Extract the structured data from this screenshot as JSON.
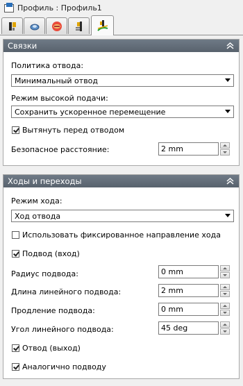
{
  "window": {
    "title": "Профиль : Профиль1"
  },
  "tabs": [
    {
      "icon": "tool-icon"
    },
    {
      "icon": "geometry-icon"
    },
    {
      "icon": "heights-icon"
    },
    {
      "icon": "passes-icon"
    },
    {
      "icon": "linking-icon",
      "active": true
    }
  ],
  "links": {
    "header": "Связки",
    "retract_policy_label": "Политика отвода:",
    "retract_policy_value": "Минимальный отвод",
    "high_feed_label": "Режим высокой подачи:",
    "high_feed_value": "Сохранить ускоренное перемещение",
    "extend_before_retract_label": "Вытянуть перед отводом",
    "extend_before_retract_checked": true,
    "safe_distance_label": "Безопасное расстояние:",
    "safe_distance_value": "2 mm"
  },
  "leads": {
    "header": "Ходы и переходы",
    "lead_mode_label": "Режим хода:",
    "lead_mode_value": "Ход отвода",
    "fixed_direction_label": "Использовать фиксированное направление хода",
    "fixed_direction_checked": false,
    "lead_in_label": "Подвод (вход)",
    "lead_in_checked": true,
    "lead_radius_label": "Радиус подвода:",
    "lead_radius_value": "0 mm",
    "linear_lead_length_label": "Длина линейного подвода:",
    "linear_lead_length_value": "2 mm",
    "lead_extension_label": "Продление подвода:",
    "lead_extension_value": "0 mm",
    "linear_lead_angle_label": "Угол линейного подвода:",
    "linear_lead_angle_value": "45 deg",
    "lead_out_label": "Отвод (выход)",
    "lead_out_checked": true,
    "same_as_lead_in_label": "Аналогично подводу",
    "same_as_lead_in_checked": true
  }
}
